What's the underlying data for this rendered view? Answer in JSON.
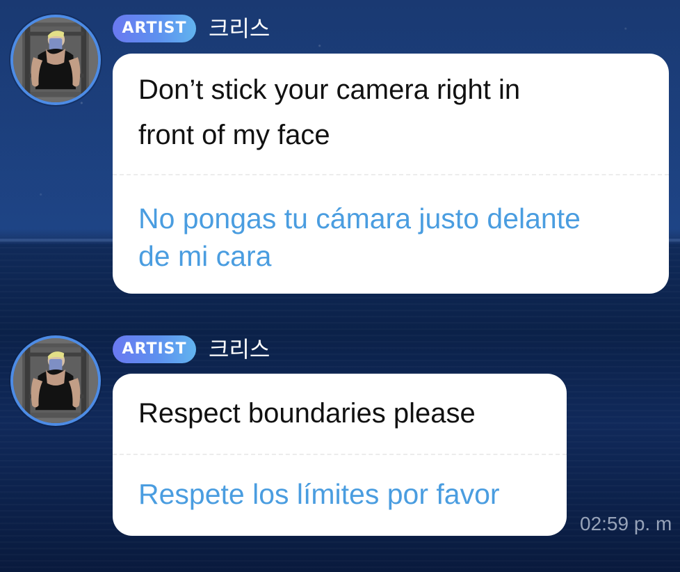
{
  "messages": [
    {
      "sender": {
        "badge": "ARTIST",
        "name": "크리스"
      },
      "text": "Don’t stick your camera right in\nfront of my face",
      "translation": "No pongas tu cámara justo delante\nde mi cara"
    },
    {
      "sender": {
        "badge": "ARTIST",
        "name": "크리스"
      },
      "text": "Respect boundaries please",
      "translation": "Respete los límites por favor"
    }
  ],
  "timestamp": "02:59 p. m",
  "colors": {
    "artist_badge_start": "#6a79f0",
    "artist_badge_end": "#62b4ef",
    "avatar_ring": "#4d8ce6",
    "translation_text": "#4a9de0",
    "bubble_background": "#ffffff",
    "timestamp_text": "#a6b1c5"
  },
  "icons": {
    "avatar": "profile-photo-icon"
  }
}
